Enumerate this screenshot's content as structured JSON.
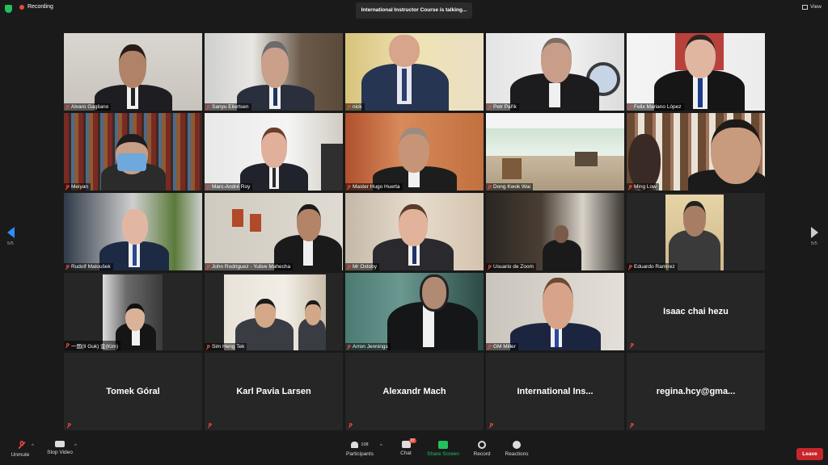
{
  "topbar": {
    "recording_label": "Recording",
    "talking_banner": "International Instructor Course is talking...",
    "view_label": "View"
  },
  "pagination": {
    "left": "5/5",
    "right": "5/5"
  },
  "participants": [
    {
      "name": "Alvaro Gagliano"
    },
    {
      "name": "Sanyu Eilertsen"
    },
    {
      "name": "nick"
    },
    {
      "name": "Petr Pařík"
    },
    {
      "name": "Felix Mariano López"
    },
    {
      "name": "Meiyan"
    },
    {
      "name": "Marc-André Roy"
    },
    {
      "name": "Master Hugo Huerta"
    },
    {
      "name": "Dong Kwok Wai"
    },
    {
      "name": "Ming Low"
    },
    {
      "name": "Rudolf Matoušek"
    },
    {
      "name": "John Rodriguez - Yulive Mahecha"
    },
    {
      "name": "Mr Oxtoby"
    },
    {
      "name": "Usuario de Zoom"
    },
    {
      "name": "Eduardo Ramirez"
    },
    {
      "name": "一国(Il Guk) 金(Kim)"
    },
    {
      "name": "Sim Heng Tek"
    },
    {
      "name": "Arron Jennings"
    },
    {
      "name": "GM Miller"
    },
    {
      "name": "Isaac chai hezu"
    },
    {
      "name": "Tomek Góral"
    },
    {
      "name": "Karl Pavia Larsen"
    },
    {
      "name": "Alexandr Mach"
    },
    {
      "name": "International  Ins..."
    },
    {
      "name": "regina.hcy@gma..."
    }
  ],
  "toolbar": {
    "unmute": "Unmute",
    "stop_video": "Stop Video",
    "participants": "Participants",
    "participants_count": "108",
    "chat": "Chat",
    "chat_badge": "37",
    "share_screen": "Share Screen",
    "record": "Record",
    "reactions": "Reactions",
    "leave": "Leave"
  },
  "colors": {
    "accent": "#2d8cff",
    "share": "#21c25e",
    "leave": "#c8252a",
    "muted": "#e54b3c"
  }
}
